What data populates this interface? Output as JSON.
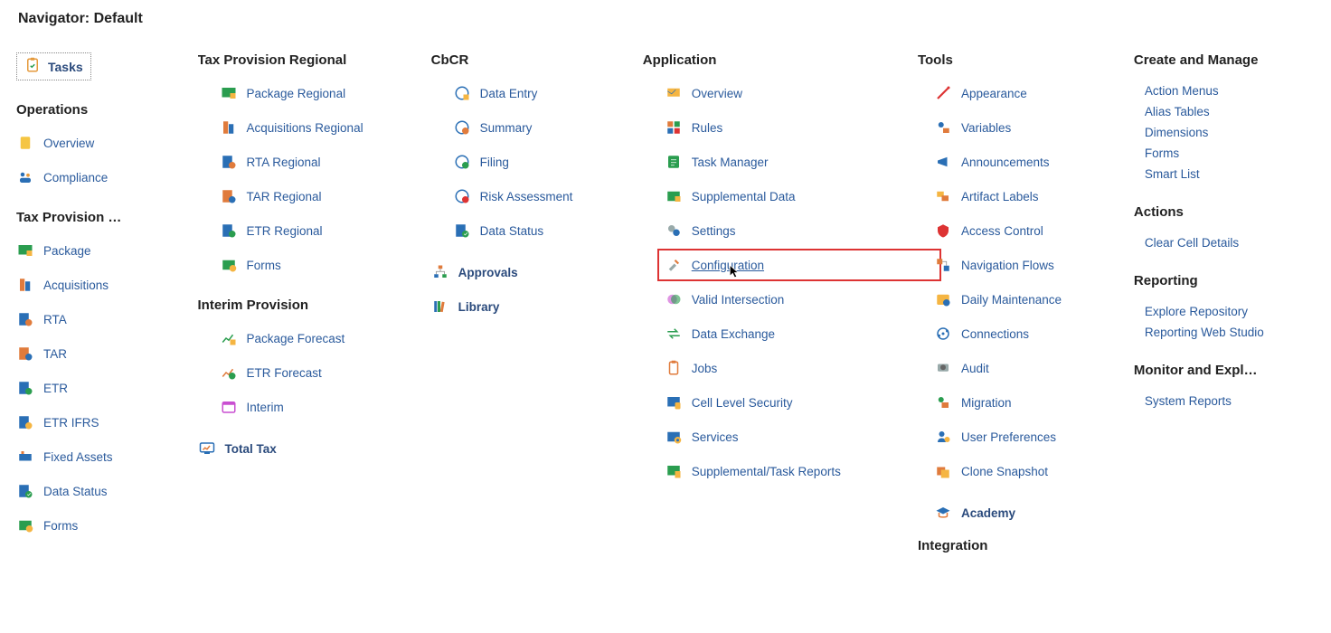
{
  "title": "Navigator: Default",
  "tasks": {
    "label": "Tasks"
  },
  "col1": {
    "operations": {
      "title": "Operations",
      "items": [
        {
          "icon": "overview",
          "label": "Overview"
        },
        {
          "icon": "compliance",
          "label": "Compliance"
        }
      ]
    },
    "taxProvision": {
      "title": "Tax Provision …",
      "items": [
        {
          "icon": "package",
          "label": "Package"
        },
        {
          "icon": "acq",
          "label": "Acquisitions"
        },
        {
          "icon": "rta",
          "label": "RTA"
        },
        {
          "icon": "tar",
          "label": "TAR"
        },
        {
          "icon": "etr",
          "label": "ETR"
        },
        {
          "icon": "etrifrs",
          "label": "ETR IFRS"
        },
        {
          "icon": "fixedassets",
          "label": "Fixed Assets"
        },
        {
          "icon": "datastatus",
          "label": "Data Status"
        },
        {
          "icon": "forms",
          "label": "Forms"
        }
      ]
    }
  },
  "col2": {
    "taxProvisionRegional": {
      "title": "Tax Provision Regional",
      "items": [
        {
          "icon": "package",
          "label": "Package Regional"
        },
        {
          "icon": "acq",
          "label": "Acquisitions Regional"
        },
        {
          "icon": "rta",
          "label": "RTA Regional"
        },
        {
          "icon": "tar",
          "label": "TAR Regional"
        },
        {
          "icon": "etr",
          "label": "ETR Regional"
        },
        {
          "icon": "forms",
          "label": "Forms"
        }
      ]
    },
    "interimProvision": {
      "title": "Interim Provision",
      "items": [
        {
          "icon": "packagefc",
          "label": "Package Forecast"
        },
        {
          "icon": "etrfc",
          "label": "ETR Forecast"
        },
        {
          "icon": "interim",
          "label": "Interim"
        }
      ]
    },
    "totalTax": {
      "icon": "totaltax",
      "label": "Total Tax"
    }
  },
  "col3": {
    "cbcr": {
      "title": "CbCR",
      "items": [
        {
          "icon": "dataentry",
          "label": "Data Entry"
        },
        {
          "icon": "summary",
          "label": "Summary"
        },
        {
          "icon": "filing",
          "label": "Filing"
        },
        {
          "icon": "risk",
          "label": "Risk Assessment"
        },
        {
          "icon": "datastatus",
          "label": "Data Status"
        }
      ]
    },
    "approvals": {
      "icon": "approvals",
      "label": "Approvals"
    },
    "library": {
      "icon": "library",
      "label": "Library"
    }
  },
  "col4": {
    "application": {
      "title": "Application",
      "items": [
        {
          "icon": "overview2",
          "label": "Overview"
        },
        {
          "icon": "rules",
          "label": "Rules"
        },
        {
          "icon": "taskmgr",
          "label": "Task Manager"
        },
        {
          "icon": "suppdata",
          "label": "Supplemental Data"
        },
        {
          "icon": "settings",
          "label": "Settings"
        },
        {
          "icon": "config",
          "label": "Configuration",
          "highlight": true
        },
        {
          "icon": "validint",
          "label": "Valid Intersection"
        },
        {
          "icon": "dataex",
          "label": "Data Exchange"
        },
        {
          "icon": "jobs",
          "label": "Jobs"
        },
        {
          "icon": "cellsec",
          "label": "Cell Level Security"
        },
        {
          "icon": "services",
          "label": "Services"
        },
        {
          "icon": "supptask",
          "label": "Supplemental/Task Reports"
        }
      ]
    }
  },
  "col5": {
    "tools": {
      "title": "Tools",
      "items": [
        {
          "icon": "appearance",
          "label": "Appearance"
        },
        {
          "icon": "variables",
          "label": "Variables"
        },
        {
          "icon": "announce",
          "label": "Announcements"
        },
        {
          "icon": "artifact",
          "label": "Artifact Labels"
        },
        {
          "icon": "access",
          "label": "Access Control"
        },
        {
          "icon": "navflow",
          "label": "Navigation Flows"
        },
        {
          "icon": "daily",
          "label": "Daily Maintenance"
        },
        {
          "icon": "connect",
          "label": "Connections"
        },
        {
          "icon": "audit",
          "label": "Audit"
        },
        {
          "icon": "migrate",
          "label": "Migration"
        },
        {
          "icon": "userpref",
          "label": "User Preferences"
        },
        {
          "icon": "clone",
          "label": "Clone Snapshot"
        }
      ]
    },
    "academy": {
      "icon": "academy",
      "label": "Academy"
    },
    "integration": {
      "title": "Integration"
    }
  },
  "col6": {
    "sections": [
      {
        "title": "Create and Manage",
        "links": [
          "Action Menus",
          "Alias Tables",
          "Dimensions",
          "Forms",
          "Smart List"
        ]
      },
      {
        "title": "Actions",
        "links": [
          "Clear Cell Details"
        ]
      },
      {
        "title": "Reporting",
        "links": [
          "Explore Repository",
          "Reporting Web Studio"
        ]
      },
      {
        "title": "Monitor and Expl…",
        "links": [
          "System Reports"
        ]
      }
    ]
  }
}
